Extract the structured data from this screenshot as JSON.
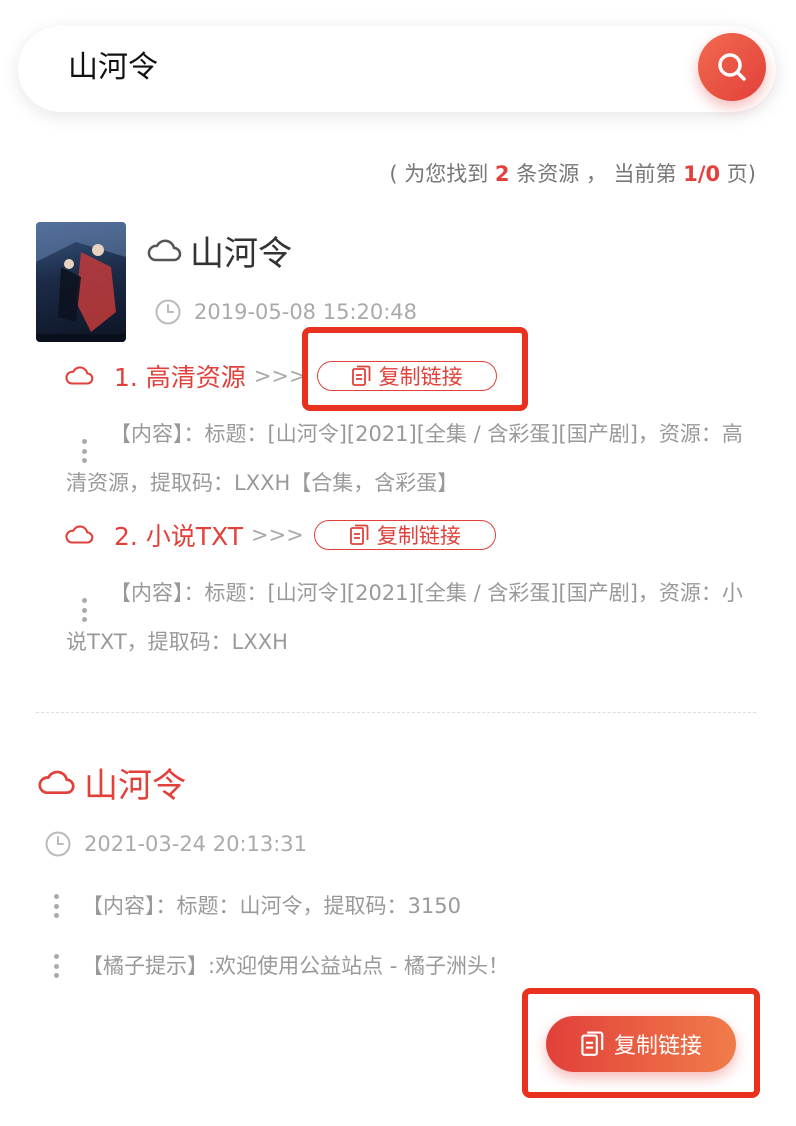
{
  "search": {
    "query": "山河令"
  },
  "summary": {
    "prefix": "( 为您找到 ",
    "count": "2",
    "middle": " 条资源 ， 当前第 ",
    "page": "1/0",
    "suffix": " 页)"
  },
  "result1": {
    "title": "山河令",
    "time": "2019-05-08 15:20:48",
    "cover_text": "山河令",
    "links": [
      {
        "label": "1. 高清资源",
        "arrows": ">>>",
        "copy_label": "复制链接",
        "content": "【内容】：标题：[山河令][2021][全集 / 含彩蛋][国产剧]，资源：高清资源，提取码：LXXH【合集，含彩蛋】"
      },
      {
        "label": "2. 小说TXT",
        "arrows": ">>>",
        "copy_label": "复制链接",
        "content": "【内容】：标题：[山河令][2021][全集 / 含彩蛋][国产剧]，资源：小说TXT，提取码：LXXH"
      }
    ]
  },
  "result2": {
    "title": "山河令",
    "time": "2021-03-24 20:13:31",
    "content": "【内容】：标题：山河令，提取码：3150",
    "tip": "【橘子提示】:欢迎使用公益站点 - 橘子洲头！",
    "copy_label": "复制链接"
  },
  "colors": {
    "accent": "#e2403a",
    "highlight_box": "#e8321f",
    "muted": "#999999"
  }
}
